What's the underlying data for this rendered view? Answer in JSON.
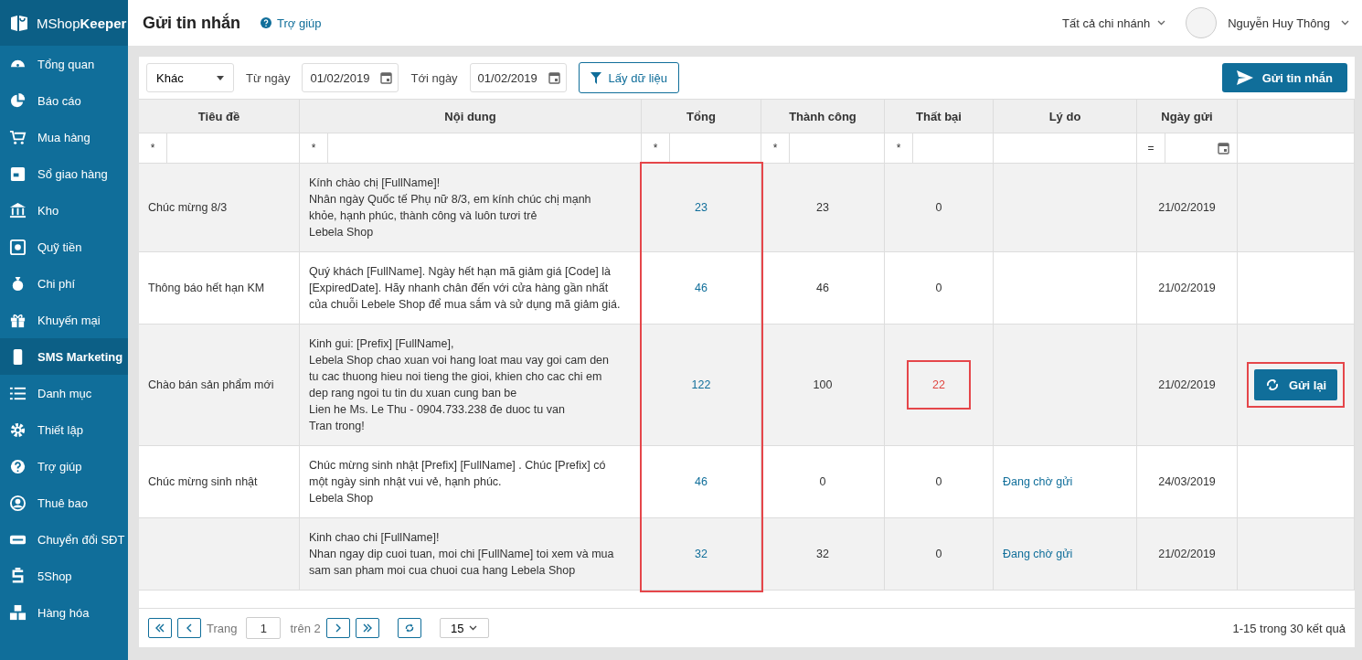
{
  "logo": "MShop**Keeper**",
  "sidebar": {
    "items": [
      {
        "label": "Tổng quan",
        "selected": false
      },
      {
        "label": "Báo cáo",
        "selected": false
      },
      {
        "label": "Mua hàng",
        "selected": false
      },
      {
        "label": "Sổ giao hàng",
        "selected": false
      },
      {
        "label": "Kho",
        "selected": false
      },
      {
        "label": "Quỹ tiền",
        "selected": false
      },
      {
        "label": "Chi phí",
        "selected": false
      },
      {
        "label": "Khuyến mại",
        "selected": false
      },
      {
        "label": "SMS Marketing",
        "selected": true
      },
      {
        "label": "Danh mục",
        "selected": false
      },
      {
        "label": "Thiết lập",
        "selected": false
      },
      {
        "label": "Trợ giúp",
        "selected": false
      },
      {
        "label": "Thuê bao",
        "selected": false
      },
      {
        "label": "Chuyển đổi SĐT",
        "selected": false
      },
      {
        "label": "5Shop",
        "selected": false
      },
      {
        "label": "Hàng hóa",
        "selected": false
      }
    ]
  },
  "header": {
    "title": "Gửi tin nhắn",
    "help_link": "Trợ giúp",
    "branch_selector": "Tất cả chi nhánh",
    "user_name": "Nguyễn Huy Thông"
  },
  "toolbar": {
    "type_select": "Khác",
    "from_label": "Từ ngày",
    "from_date": "01/02/2019",
    "to_label": "Tới ngày",
    "to_date": "01/02/2019",
    "fetch_button": "Lấy dữ liệu",
    "send_button": "Gửi tin nhắn"
  },
  "table": {
    "columns": [
      {
        "label": "Tiêu đề"
      },
      {
        "label": "Nội dung"
      },
      {
        "label": "Tổng",
        "highlighted": true
      },
      {
        "label": "Thành công"
      },
      {
        "label": "Thất bại"
      },
      {
        "label": "Lý do"
      },
      {
        "label": "Ngày gửi"
      }
    ],
    "filters": [
      {
        "kind": "text",
        "operator": "*"
      },
      {
        "kind": "text",
        "operator": "*"
      },
      {
        "kind": "text",
        "operator": "*"
      },
      {
        "kind": "text",
        "operator": "*"
      },
      {
        "kind": "text",
        "operator": "*"
      },
      {
        "kind": "none"
      },
      {
        "kind": "date",
        "operator": "="
      },
      {
        "kind": "none"
      }
    ],
    "rows": [
      {
        "title": "Chúc mừng 8/3",
        "content": "Kính chào chị [FullName]!\nNhân ngày Quốc tế Phụ nữ 8/3, em kính chúc chị mạnh\nkhỏe, hạnh phúc, thành công và luôn tươi trẻ\nLebela Shop",
        "total": "23",
        "success": "23",
        "failed": "0",
        "failed_alert": false,
        "failed_highlighted": false,
        "date": "21/02/2019"
      },
      {
        "title": "Thông báo hết hạn KM",
        "content": "Quý khách [FullName]. Ngày hết hạn mã giảm giá [Code] là\n[ExpiredDate]. Hãy nhanh chân đến với cửa hàng gần nhất\ncủa chuỗi Lebele Shop để mua sắm và sử dụng mã giảm giá.",
        "total": "46",
        "success": "46",
        "failed": "0",
        "failed_alert": false,
        "failed_highlighted": false,
        "date": "21/02/2019"
      },
      {
        "title": "Chào bán sản phẩm mới",
        "content": "Kinh gui: [Prefix] [FullName],\nLebela Shop chao xuan voi hang loat mau vay goi cam den\ntu cac thuong hieu noi tieng the gioi, khien cho cac chi em\ndep rang ngoi tu tin du xuan cung ban be\nLien he Ms. Le Thu - 0904.733.238 đe duoc tu van\nTran trong!",
        "total": "122",
        "success": "100",
        "failed": "22",
        "failed_alert": true,
        "failed_highlighted": true,
        "date": "21/02/2019",
        "action": {
          "label": "Gửi lại",
          "highlighted": true
        }
      },
      {
        "title": "Chúc mừng sinh nhật",
        "content": "Chúc mừng sinh nhật [Prefix] [FullName] . Chúc [Prefix] có\nmột ngày sinh nhật vui vẻ, hạnh phúc.\nLebela Shop",
        "total": "46",
        "success": "0",
        "failed": "0",
        "failed_alert": false,
        "failed_highlighted": false,
        "reason": "Đang chờ gửi",
        "date": "24/03/2019"
      },
      {
        "content": "Kinh chao chi [FullName]!\nNhan ngay dip cuoi tuan, moi chi [FullName] toi xem và mua\nsam san pham moi cua chuoi cua hang Lebela Shop",
        "total": "32",
        "success": "32",
        "failed": "0",
        "failed_alert": false,
        "failed_highlighted": false,
        "reason": "Đang chờ gửi",
        "date": "21/02/2019"
      }
    ]
  },
  "pagination": {
    "page_label": "Trang",
    "page": "1",
    "of_label": "trên 2",
    "page_size": "15",
    "summary": "1-15 trong 30 kết quả"
  }
}
